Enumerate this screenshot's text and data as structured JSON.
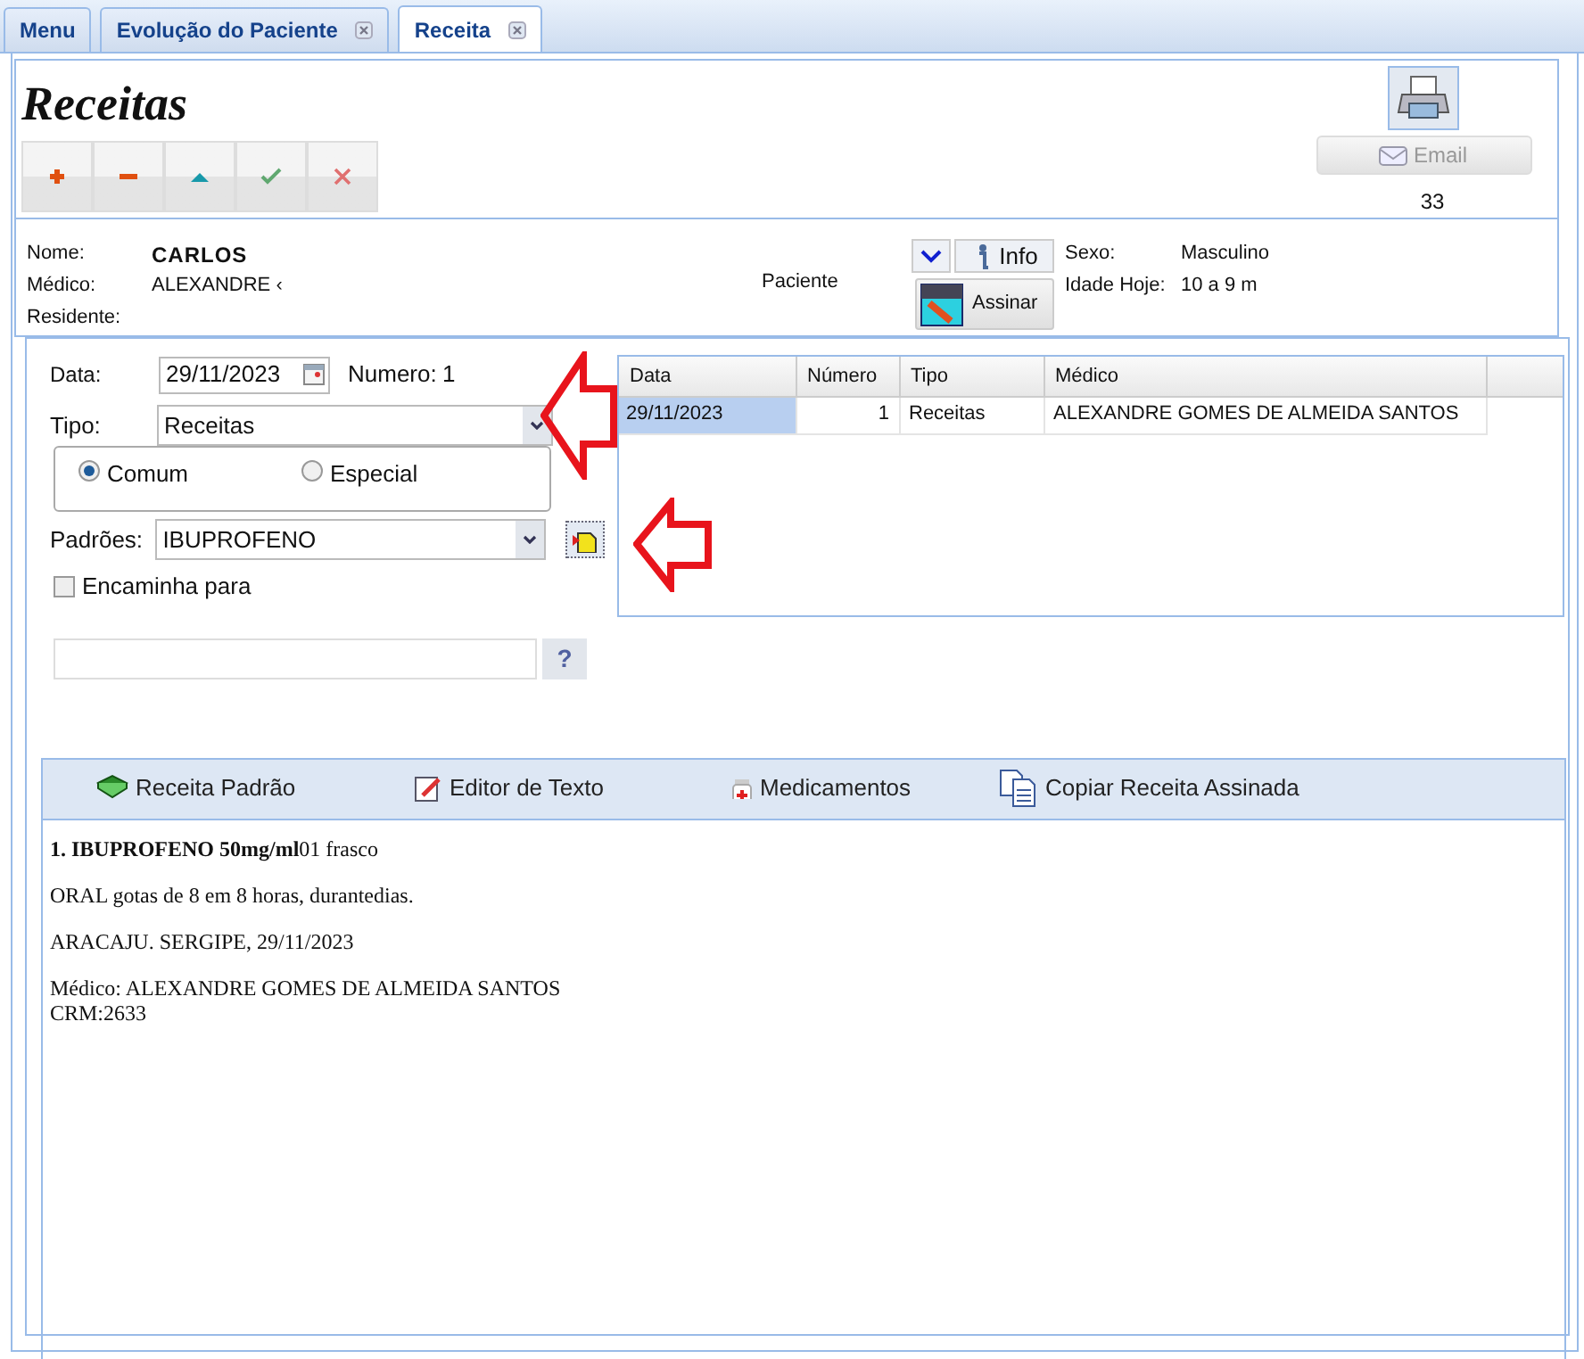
{
  "tabs": [
    {
      "label": "Menu",
      "selected": false,
      "closable": false
    },
    {
      "label": "Evolução do Paciente",
      "selected": false,
      "closable": true
    },
    {
      "label": "Receita",
      "selected": true,
      "closable": true
    }
  ],
  "title": "Receitas",
  "toolbar": [
    {
      "kind": "add"
    },
    {
      "kind": "remove"
    },
    {
      "kind": "up"
    },
    {
      "kind": "confirm"
    },
    {
      "kind": "cancel"
    }
  ],
  "email_button": {
    "label": "Email",
    "disabled": true
  },
  "count": "33",
  "patient": {
    "fields": [
      {
        "label": "Nome:",
        "value": "CARLOS"
      },
      {
        "label": "Médico:",
        "value": "ALEXANDRE ‹"
      },
      {
        "label": "Residente:"
      }
    ],
    "center_label": "Paciente",
    "info_button": "Info",
    "sign_button": "Assinar",
    "right_fields": [
      {
        "label": "Sexo:",
        "value": "Masculino"
      },
      {
        "label": "Idade Hoje:",
        "value": "10 a 9 m"
      }
    ]
  },
  "form": {
    "date_label": "Data:",
    "date": "29/11/2023",
    "number_label": "Numero:",
    "number": "1",
    "type_label": "Tipo:",
    "type": "Receitas",
    "radios": [
      {
        "label": "Comum",
        "selected": true
      },
      {
        "label": "Especial",
        "selected": false
      }
    ],
    "defaults_label": "Padrões:",
    "defaults": "IBUPROFENO",
    "forward": {
      "label": "Encaminha para",
      "checked": false
    },
    "help_button": "?"
  },
  "table": {
    "columns": [
      "Data",
      "Número",
      "Tipo",
      "Médico"
    ],
    "rows": [
      {
        "cells": [
          "29/11/2023",
          "1",
          "Receitas",
          "ALEXANDRE GOMES DE ALMEIDA SANTOS"
        ],
        "selected": true
      }
    ]
  },
  "editor": {
    "tools": [
      {
        "kind": "book",
        "label": "Receita Padrão"
      },
      {
        "kind": "edit",
        "label": "Editor de Texto"
      },
      {
        "kind": "medicine",
        "label": "Medicamentos"
      },
      {
        "kind": "copy",
        "label": "Copiar Receita Assinada"
      }
    ],
    "paragraphs": [
      [
        "**1. IBUPROFENO 50mg/ml**01 frasco"
      ],
      [
        "ORAL gotas de 8 em 8 horas, durantedias."
      ],
      [
        "ARACAJU. SERGIPE, 29/11/2023"
      ],
      [
        "Médico: ALEXANDRE GOMES DE ALMEIDA SANTOS",
        "CRM:2633"
      ]
    ]
  }
}
